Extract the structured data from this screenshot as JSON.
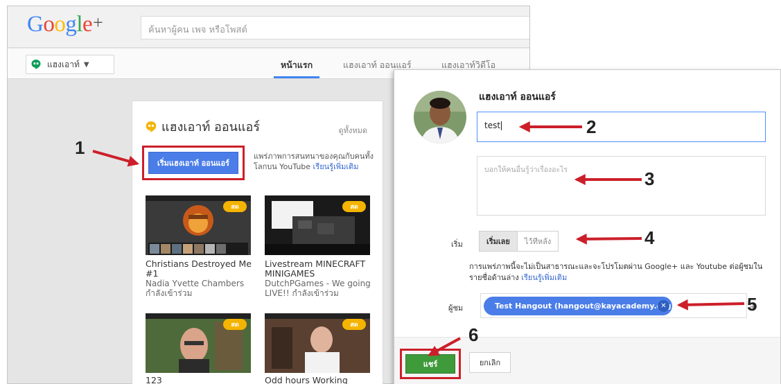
{
  "header": {
    "logo_text": "Google",
    "logo_plus": "+",
    "search_placeholder": "ค้นหาผู้คน เพจ หรือโพสต์"
  },
  "nav": {
    "selector_label": "แฮงเอาท์",
    "tabs": [
      {
        "label": "หน้าแรก",
        "active": true
      },
      {
        "label": "แฮงเอาท์ ออนแอร์",
        "active": false
      },
      {
        "label": "แฮงเอาท์วิดีโอ",
        "active": false
      }
    ]
  },
  "card": {
    "title": "แฮงเอาท์ ออนแอร์",
    "see_all": "ดูทั้งหมด",
    "start_button": "เริ่มแฮงเอาท์ ออนแอร์",
    "description": "แพร่ภาพการสนทนาของคุณกับคนทั้งโลกบน YouTube",
    "learn_more": "เรียนรู้เพิ่มเติม",
    "live_badge": "สด",
    "videos": [
      {
        "title": "Christians Destroyed Me #1",
        "sub": "Nadia Yvette Chambers กำลังเข้าร่วม"
      },
      {
        "title": "Livestream MINECRAFT MINIGAMES",
        "sub": "DutchPGames - We going LIVE!! กำลังเข้าร่วม"
      },
      {
        "title": "123",
        "sub": ""
      },
      {
        "title": "Odd hours Working",
        "sub": ""
      }
    ]
  },
  "dialog": {
    "title": "แฮงเอาท์ ออนแอร์",
    "name_value": "test",
    "description_placeholder": "บอกให้คนอื่นรู้ว่าเรื่องอะไร",
    "start_label": "เริ่ม",
    "start_now": "เริ่มเลย",
    "start_later": "ไว้ทีหลัง",
    "notice": "การแพร่ภาพนี้จะไม่เป็นสาธารณะและจะโปรโมตผ่าน Google+ และ Youtube ต่อผู้ชมในรายชื่อด้านล่าง",
    "notice_link": "เรียนรู้เพิ่มเติม",
    "audience_label": "ผู้ชม",
    "audience_chip": "Test Hangout (hangout@kayacademy.org)",
    "add_icon": "+",
    "share_button": "แชร์",
    "cancel_button": "ยกเลิก"
  },
  "annotations": {
    "steps": [
      "1",
      "2",
      "3",
      "4",
      "5",
      "6"
    ],
    "highlight_color": "#cc1f2a",
    "arrow_color": "#cc1f2a"
  },
  "colors": {
    "accent_blue": "#4285f4",
    "button_blue": "#4a7de8",
    "share_green": "#3f9a3a",
    "live_yellow": "#f4b400",
    "hangouts_green": "#0f9d58"
  }
}
